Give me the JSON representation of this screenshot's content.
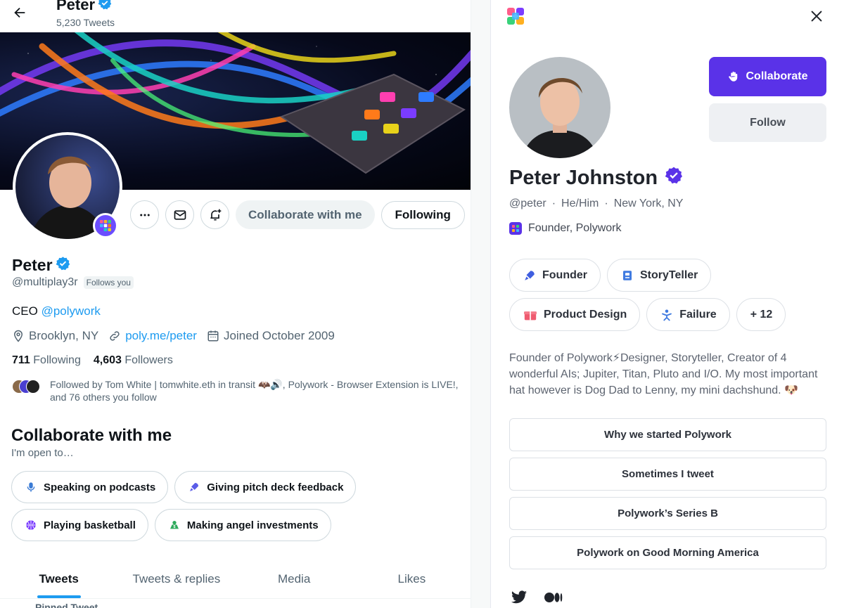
{
  "twitter": {
    "header": {
      "name": "Peter",
      "tweet_count": "5,230 Tweets"
    },
    "actions": {
      "collaborate_label": "Collaborate with me",
      "following_label": "Following"
    },
    "profile": {
      "name": "Peter",
      "handle": "@multiplay3r",
      "follows_you": "Follows you",
      "bio_prefix": "CEO",
      "bio_link": "@polywork",
      "location": "Brooklyn, NY",
      "website": "poly.me/peter",
      "joined": "Joined October 2009",
      "following_count": "711",
      "following_label": "Following",
      "followers_count": "4,603",
      "followers_label": "Followers",
      "followed_by": "Followed by Tom White | tomwhite.eth in transit 🦇🔊, Polywork - Browser Extension is LIVE!, and 76 others you follow"
    },
    "collab": {
      "title": "Collaborate with me",
      "subtitle": "I'm open to…",
      "items": [
        {
          "label": "Speaking on podcasts",
          "icon": "microphone-icon"
        },
        {
          "label": "Giving pitch deck feedback",
          "icon": "rocket-icon"
        },
        {
          "label": "Playing basketball",
          "icon": "basketball-icon"
        },
        {
          "label": "Making angel investments",
          "icon": "money-icon"
        }
      ]
    },
    "tabs": [
      "Tweets",
      "Tweets & replies",
      "Media",
      "Likes"
    ],
    "active_tab": "Tweets",
    "pinned_peek": "Pinned Tweet",
    "accent_color": "#1d9bf0"
  },
  "polywork": {
    "collaborate_label": "Collaborate",
    "follow_label": "Follow",
    "name": "Peter Johnston",
    "handle": "@peter",
    "pronouns": "He/Him",
    "location": "New York, NY",
    "role": "Founder, Polywork",
    "badges": [
      {
        "label": "Founder",
        "icon": "rocket-icon"
      },
      {
        "label": "StoryTeller",
        "icon": "book-icon"
      },
      {
        "label": "Product Design",
        "icon": "gift-icon"
      },
      {
        "label": "Failure",
        "icon": "fall-icon"
      },
      {
        "label": "+ 12",
        "icon": ""
      }
    ],
    "bio": "Founder of Polywork⚡Designer, Storyteller, Creator of 4 wonderful AIs; Jupiter, Titan, Pluto and I/O. My most important hat however is Dog Dad to Lenny, my mini dachshund. 🐶",
    "links": [
      "Why we started Polywork",
      "Sometimes I tweet",
      "Polywork’s Series B",
      "Polywork on Good Morning America"
    ],
    "brand_color": "#5a32e8"
  }
}
